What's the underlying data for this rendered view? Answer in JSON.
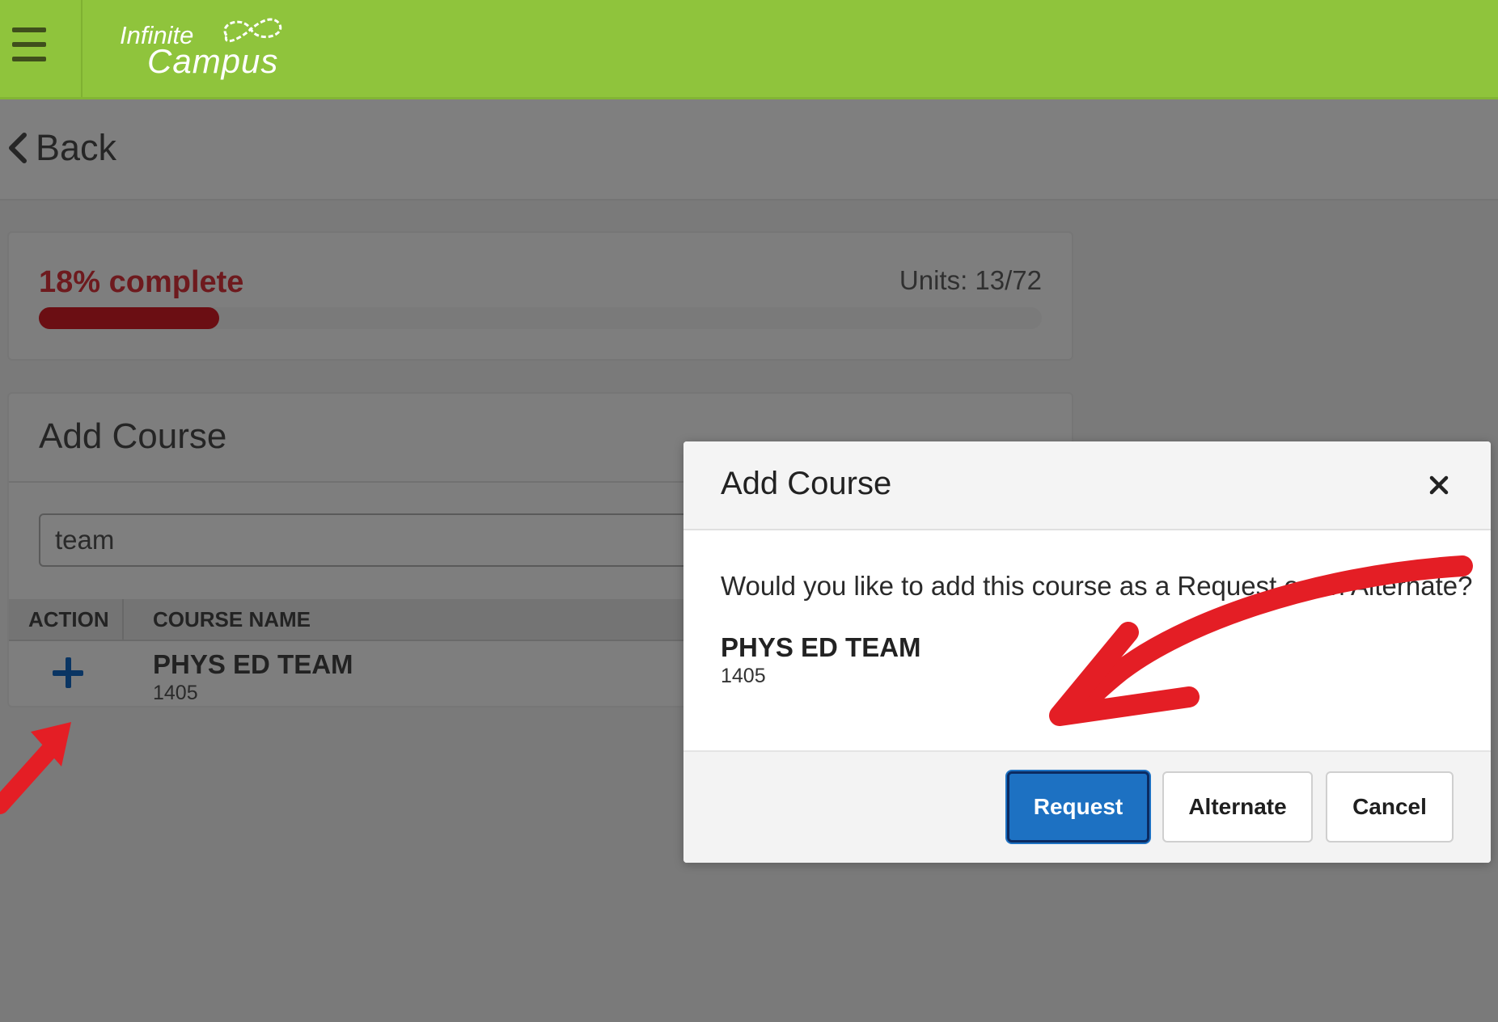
{
  "header": {
    "logo_line1": "Infinite",
    "logo_line2": "Campus",
    "menu_icon": "hamburger-menu-icon",
    "brand_color": "#8fc43c"
  },
  "nav": {
    "back_label": "Back",
    "back_icon": "chevron-left-icon"
  },
  "progress": {
    "percent_label": "18% complete",
    "units_label": "Units: 13/72",
    "fraction": 0.18,
    "fill_color": "#6b0e13"
  },
  "add_course": {
    "title": "Add Course",
    "search_value": "team",
    "columns": [
      "ACTION",
      "COURSE NAME"
    ],
    "rows": [
      {
        "name": "PHYS ED TEAM",
        "number": "1405",
        "action_icon": "plus-icon"
      }
    ]
  },
  "modal": {
    "title": "Add Course",
    "close_icon": "close-icon",
    "question": "Would you like to add this course as a Request or an Alternate?",
    "course_name": "PHYS ED TEAM",
    "course_number": "1405",
    "buttons": {
      "request": "Request",
      "alternate": "Alternate",
      "cancel": "Cancel"
    },
    "primary_color": "#1d71c2"
  }
}
